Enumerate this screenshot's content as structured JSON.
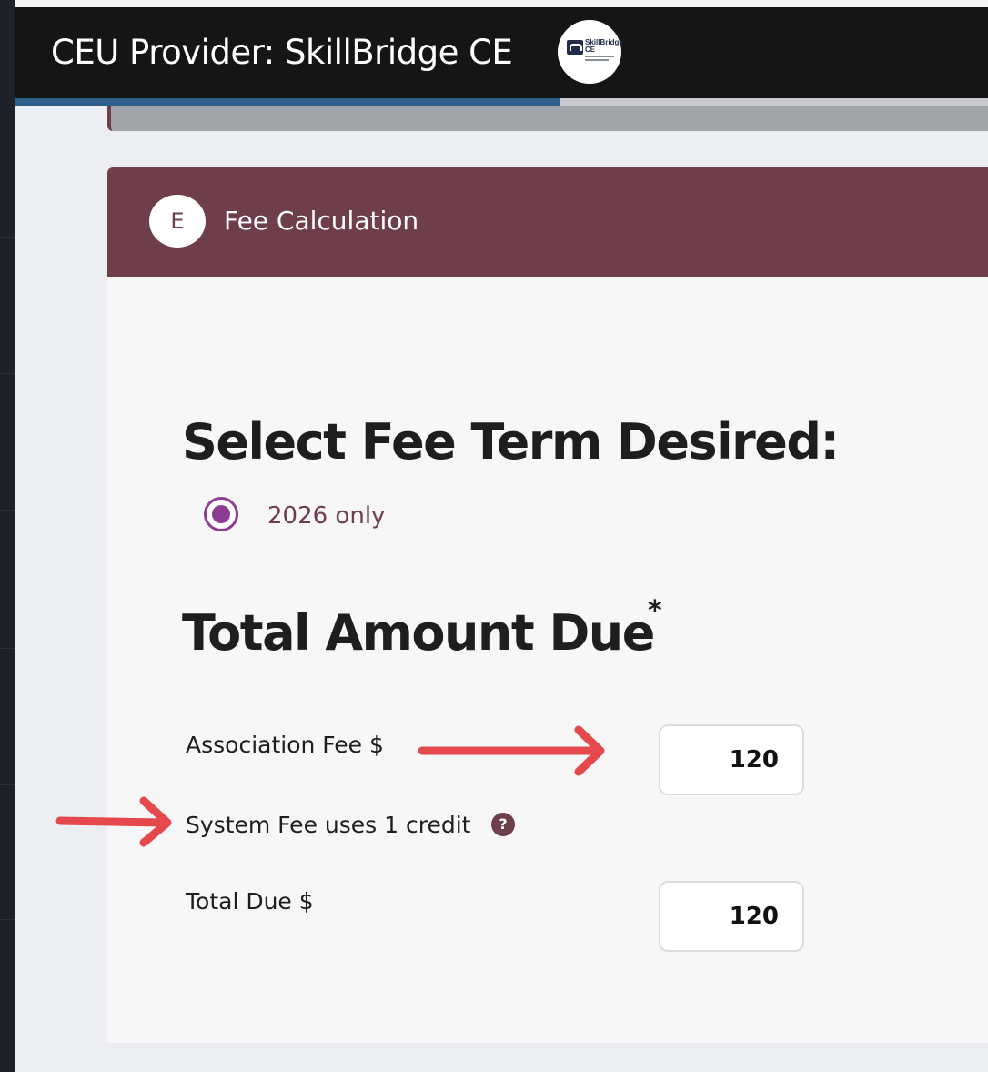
{
  "header": {
    "title": "CEU Provider: SkillBridge CE",
    "logo_text_line1": "SkillBridge",
    "logo_text_line2": "CE"
  },
  "progress": {
    "percent": 56
  },
  "section": {
    "step_letter": "E",
    "title": "Fee Calculation"
  },
  "fee_term": {
    "heading": "Select Fee Term Desired:",
    "options": [
      {
        "label": "2026 only",
        "selected": true
      }
    ]
  },
  "total_amount": {
    "heading": "Total Amount Due",
    "required_mark": "*",
    "association_fee_label": "Association Fee $",
    "association_fee_value": "120",
    "system_fee_label": "System Fee uses 1 credit",
    "help_icon_text": "?",
    "total_due_label": "Total Due $",
    "total_due_value": "120"
  },
  "colors": {
    "header_bg": "#151515",
    "section_header_bg": "#6e3e4b",
    "radio_accent": "#8c3c92",
    "annotation_arrow": "#e5484d"
  },
  "icons": [
    "skillbridge-logo",
    "radio-selected-icon",
    "help-icon",
    "annotation-arrow"
  ]
}
